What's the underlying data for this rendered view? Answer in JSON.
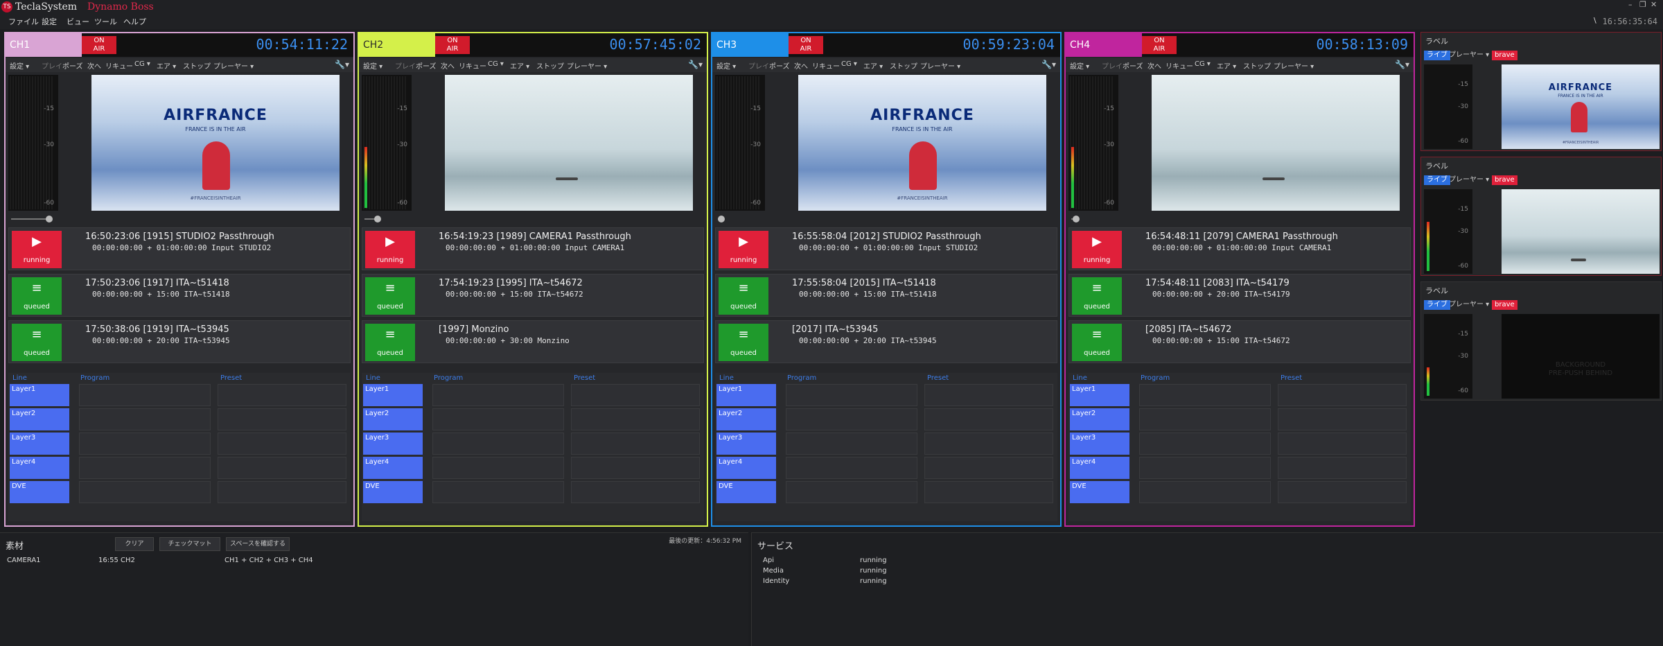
{
  "app": {
    "logo_text": "TS",
    "name": "TeclaSystem",
    "product": "Dynamo Boss",
    "clock": "16:56:35:64",
    "clock_marker": "\\"
  },
  "window_controls": [
    "–",
    "❐",
    "✕"
  ],
  "menu": [
    "ファイル",
    "設定",
    "ビュー",
    "ツール",
    "ヘルプ"
  ],
  "toolbar": {
    "settings": "設定 ▾",
    "play": "プレイ",
    "pause": "ポーズ",
    "next": "次へ",
    "requeue": "リキュー",
    "cg": "CG ▾",
    "air": "エア ▾",
    "stop": "ストップ",
    "player": "プレーヤー ▾",
    "wrench": "🔧▾"
  },
  "meter_ticks": [
    "-15",
    "-30",
    "-60"
  ],
  "onair": {
    "line1": "ON",
    "line2": "AIR"
  },
  "lpp_headers": {
    "line": "Line",
    "program": "Program",
    "preset": "Preset"
  },
  "layers": [
    "Layer1",
    "Layer2",
    "Layer3",
    "Layer4",
    "DVE"
  ],
  "video_text": {
    "airfrance": "AIRFRANCE",
    "slogan": "FRANCE IS IN THE AIR",
    "tag": "#FRANCEISINTHEAIR"
  },
  "channels": [
    {
      "name": "CH1",
      "time": "00:54:11:22",
      "color": "#d9a4d4",
      "border": "#d9a4d4",
      "video": "airfrance",
      "level": 0,
      "scrub": 0.14,
      "rows": [
        {
          "status": "running",
          "line1": "16:50:23:06  [1915] STUDIO2 Passthrough",
          "line2": "00:00:00:00 + 01:00:00:00 Input STUDIO2"
        },
        {
          "status": "queued",
          "line1": "17:50:23:06  [1917] ITA~t51418",
          "line2": "00:00:00:00 + 15:00 ITA~t51418"
        },
        {
          "status": "queued",
          "line1": "17:50:38:06  [1919] ITA~t53945",
          "line2": "00:00:00:00 + 20:00 ITA~t53945"
        }
      ]
    },
    {
      "name": "CH2",
      "time": "00:57:45:02",
      "color": "#d4f04a",
      "border": "#d4f04a",
      "video": "sky",
      "level": 0.46,
      "scrub": 0.05,
      "rows": [
        {
          "status": "running",
          "line1": "16:54:19:23  [1989] CAMERA1 Passthrough",
          "line2": "00:00:00:00 + 01:00:00:00 Input CAMERA1"
        },
        {
          "status": "queued",
          "line1": "17:54:19:23  [1995] ITA~t54672",
          "line2": "00:00:00:00 + 15:00 ITA~t54672"
        },
        {
          "status": "queued",
          "line1": "[1997] Monzino",
          "line2": "00:00:00:00 + 30:00 Monzino"
        }
      ]
    },
    {
      "name": "CH3",
      "time": "00:59:23:04",
      "color": "#1e8fe8",
      "border": "#1e8fe8",
      "video": "airfrance",
      "level": 0,
      "scrub": 0.01,
      "rows": [
        {
          "status": "running",
          "line1": "16:55:58:04  [2012] STUDIO2 Passthrough",
          "line2": "00:00:00:00 + 01:00:00:00 Input STUDIO2"
        },
        {
          "status": "queued",
          "line1": "17:55:58:04  [2015] ITA~t51418",
          "line2": "00:00:00:00 + 15:00 ITA~t51418"
        },
        {
          "status": "queued",
          "line1": "[2017] ITA~t53945",
          "line2": "00:00:00:00 + 20:00 ITA~t53945"
        }
      ]
    },
    {
      "name": "CH4",
      "time": "00:58:13:09",
      "color": "#c0259e",
      "border": "#c0259e",
      "video": "sky",
      "level": 0.46,
      "scrub": 0.02,
      "rows": [
        {
          "status": "running",
          "line1": "16:54:48:11  [2079] CAMERA1 Passthrough",
          "line2": "00:00:00:00 + 01:00:00:00 Input CAMERA1"
        },
        {
          "status": "queued",
          "line1": "17:54:48:11  [2083] ITA~t54179",
          "line2": "00:00:00:00 + 20:00 ITA~t54179"
        },
        {
          "status": "queued",
          "line1": "[2085] ITA~t54672",
          "line2": "00:00:00:00 + 15:00 ITA~t54672"
        }
      ]
    }
  ],
  "preview_cards": [
    {
      "label": "ラベル",
      "live": "ライブ",
      "player": "プレーヤー ▾",
      "brave": "brave",
      "video": "airfrance",
      "level": 0
    },
    {
      "label": "ラベル",
      "live": "ライブ",
      "player": "プレーヤー ▾",
      "brave": "brave",
      "video": "sky",
      "level": 0.6
    },
    {
      "label": "ラベル",
      "live": "ライブ",
      "player": "プレーヤー ▾",
      "brave": "brave",
      "video": "black",
      "level": 0.35,
      "overlay": [
        "BACKGROUND",
        "PRE-PUSH BEHIND"
      ]
    }
  ],
  "materials": {
    "title": "素材",
    "buttons": [
      "クリア",
      "チェックマット",
      "スペースを確認する"
    ],
    "last_updated": "最後の更新：4:56:32 PM",
    "row": {
      "name": "CAMERA1",
      "time": "16:55 CH2",
      "channels": "CH1 + CH2 + CH3 + CH4"
    }
  },
  "services": {
    "title": "サービス",
    "items": [
      {
        "name": "Api",
        "state": "running"
      },
      {
        "name": "Media",
        "state": "running"
      },
      {
        "name": "Identity",
        "state": "running"
      }
    ]
  }
}
